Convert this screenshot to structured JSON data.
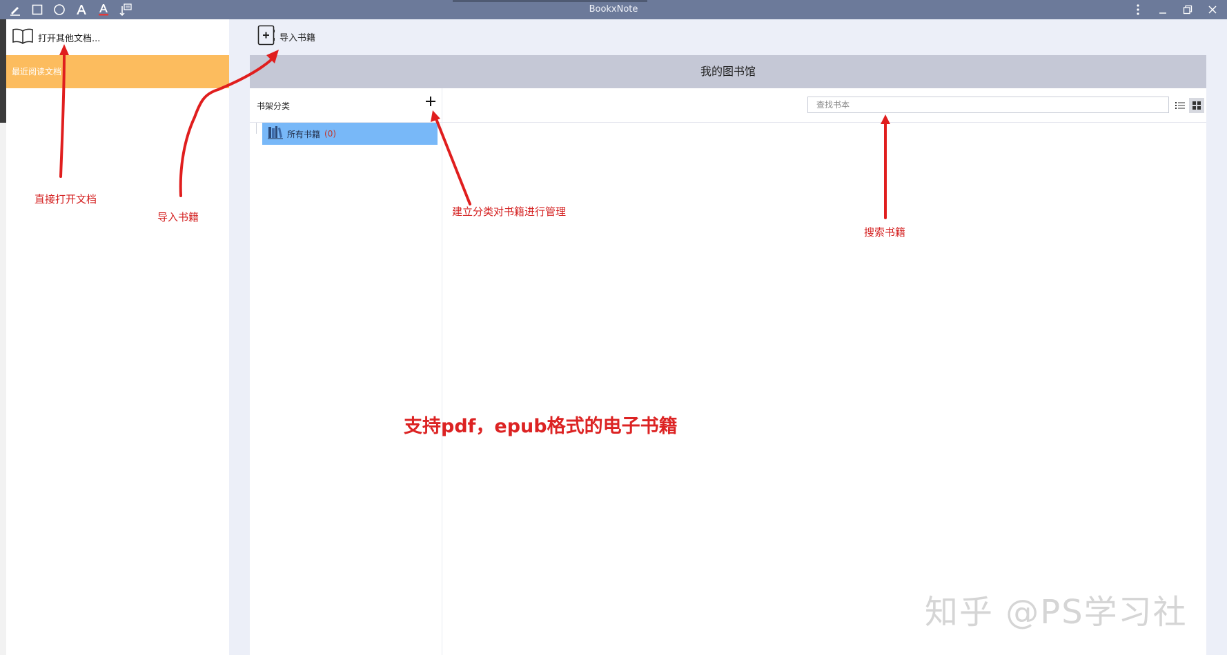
{
  "window": {
    "title": "BookxNote",
    "tools": [
      "pencil-icon",
      "rectangle-icon",
      "circle-icon",
      "text-icon",
      "text-color-icon",
      "note-insert-icon"
    ],
    "controls": [
      "more-icon",
      "minimize-icon",
      "restore-icon",
      "close-icon"
    ]
  },
  "sidebar": {
    "open_doc_label": "打开其他文档...",
    "recent_label": "最近阅读文档",
    "recent_color": "#fcbc5e"
  },
  "toolbar": {
    "import_label": "导入书籍"
  },
  "library": {
    "title": "我的图书馆",
    "shelf_label": "书架分类",
    "search_placeholder": "查找书本",
    "all_books_label": "所有书籍",
    "all_books_count": "(0)",
    "selected_color": "#78b8f8"
  },
  "annotations": {
    "open_doc": "直接打开文档",
    "import": "导入书籍",
    "category": "建立分类对书籍进行管理",
    "search": "搜索书籍",
    "formats": "支持pdf，epub格式的电子书籍",
    "color": "#d42020"
  },
  "watermark": "知乎 @PS学习社"
}
